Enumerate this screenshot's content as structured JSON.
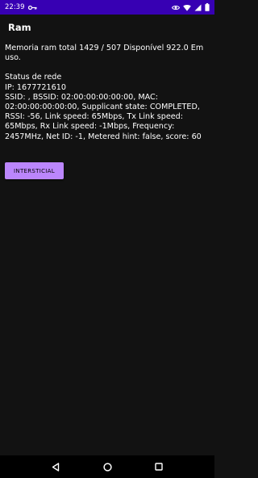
{
  "status_bar": {
    "time": "22:39",
    "left_icons": [
      "key-icon"
    ],
    "right_icons": [
      "eye-icon",
      "wifi-icon",
      "signal-icon",
      "battery-icon"
    ],
    "background_color": "#3700B3"
  },
  "app_bar": {
    "title": "Ram"
  },
  "memory": {
    "text": "Memoria ram total 1429 / 507 Disponível 922.0 Em uso."
  },
  "network": {
    "title": "Status de rede",
    "ip": "IP: 1677721610",
    "wifi_info": "SSID: , BSSID: 02:00:00:00:00:00, MAC: 02:00:00:00:00:00, Supplicant state: COMPLETED, RSSI: -56, Link speed: 65Mbps, Tx Link speed: 65Mbps, Rx Link speed: -1Mbps, Frequency: 2457MHz, Net ID: -1, Metered hint: false, score: 60"
  },
  "button": {
    "label": "INTERSTICIAL",
    "color": "#BB86FC"
  },
  "nav_bar": {
    "items": [
      "back-icon",
      "home-icon",
      "recents-icon"
    ]
  }
}
